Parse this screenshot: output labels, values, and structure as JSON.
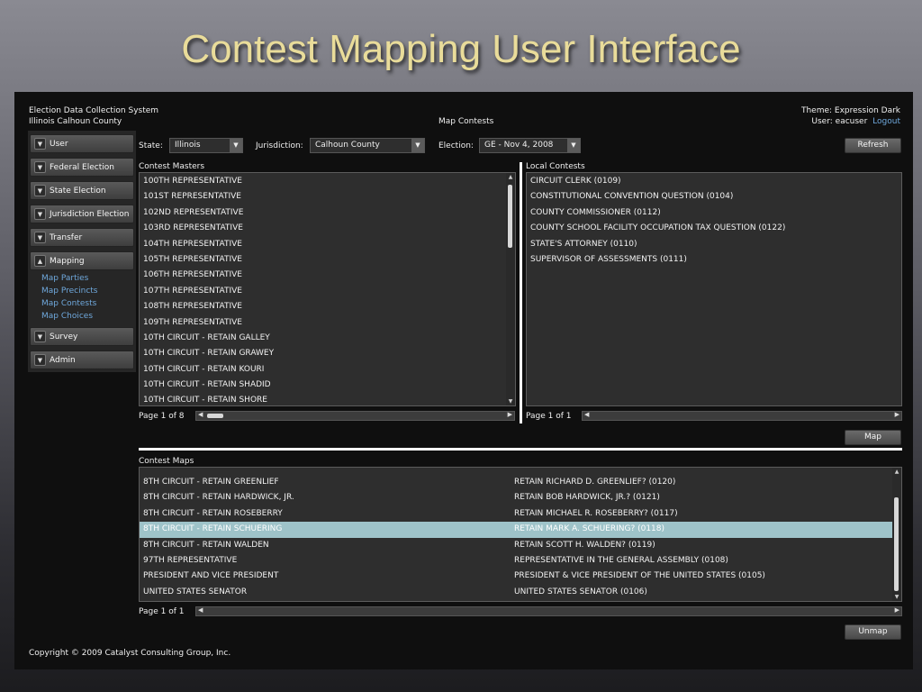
{
  "slide_title": "Contest Mapping User Interface",
  "header": {
    "system_name": "Election Data Collection System",
    "county": "Illinois Calhoun County",
    "page_name": "Map Contests",
    "theme": "Theme: Expression Dark",
    "user": "User: eacuser",
    "logout": "Logout"
  },
  "sidebar": {
    "items": [
      {
        "label": "User"
      },
      {
        "label": "Federal Election"
      },
      {
        "label": "State Election"
      },
      {
        "label": "Jurisdiction Election"
      },
      {
        "label": "Transfer"
      },
      {
        "label": "Mapping"
      }
    ],
    "mapping_links": [
      "Map Parties",
      "Map Precincts",
      "Map Contests",
      "Map Choices"
    ],
    "items_after": [
      {
        "label": "Survey"
      },
      {
        "label": "Admin"
      }
    ]
  },
  "filters": {
    "state_label": "State:",
    "state_value": "Illinois",
    "jurisdiction_label": "Jurisdiction:",
    "jurisdiction_value": "Calhoun County",
    "election_label": "Election:",
    "election_value": "GE - Nov 4, 2008",
    "refresh": "Refresh"
  },
  "contest_masters": {
    "title": "Contest Masters",
    "rows": [
      "100TH REPRESENTATIVE",
      "101ST REPRESENTATIVE",
      "102ND REPRESENTATIVE",
      "103RD REPRESENTATIVE",
      "104TH REPRESENTATIVE",
      "105TH REPRESENTATIVE",
      "106TH REPRESENTATIVE",
      "107TH REPRESENTATIVE",
      "108TH REPRESENTATIVE",
      "109TH REPRESENTATIVE",
      "10TH CIRCUIT - RETAIN GALLEY",
      "10TH CIRCUIT - RETAIN GRAWEY",
      "10TH CIRCUIT - RETAIN KOURI",
      "10TH CIRCUIT - RETAIN SHADID",
      "10TH CIRCUIT - RETAIN SHORE"
    ],
    "page": "Page 1 of 8"
  },
  "local_contests": {
    "title": "Local Contests",
    "rows": [
      "CIRCUIT CLERK (0109)",
      "CONSTITUTIONAL CONVENTION QUESTION (0104)",
      "COUNTY COMMISSIONER (0112)",
      "COUNTY SCHOOL FACILITY OCCUPATION TAX QUESTION (0122)",
      "STATE'S ATTORNEY (0110)",
      "SUPERVISOR OF ASSESSMENTS (0111)"
    ],
    "page": "Page 1 of 1",
    "map_button": "Map"
  },
  "contest_maps": {
    "title": "Contest Maps",
    "rows": [
      {
        "master": "8TH CIRCUIT - RETAIN GREENLIEF",
        "local": "RETAIN RICHARD D. GREENLIEF? (0120)",
        "selected": false
      },
      {
        "master": "8TH CIRCUIT - RETAIN HARDWICK, JR.",
        "local": "RETAIN BOB HARDWICK, JR.? (0121)",
        "selected": false
      },
      {
        "master": "8TH CIRCUIT - RETAIN ROSEBERRY",
        "local": "RETAIN MICHAEL R. ROSEBERRY? (0117)",
        "selected": false
      },
      {
        "master": "8TH CIRCUIT - RETAIN SCHUERING",
        "local": "RETAIN MARK A. SCHUERING? (0118)",
        "selected": true
      },
      {
        "master": "8TH CIRCUIT - RETAIN WALDEN",
        "local": "RETAIN SCOTT H. WALDEN? (0119)",
        "selected": false
      },
      {
        "master": "97TH REPRESENTATIVE",
        "local": "REPRESENTATIVE IN THE GENERAL ASSEMBLY (0108)",
        "selected": false
      },
      {
        "master": "PRESIDENT AND VICE PRESIDENT",
        "local": "PRESIDENT & VICE PRESIDENT OF THE UNITED STATES (0105)",
        "selected": false
      },
      {
        "master": "UNITED STATES SENATOR",
        "local": "UNITED STATES SENATOR (0106)",
        "selected": false
      }
    ],
    "page": "Page 1 of 1",
    "unmap_button": "Unmap"
  },
  "footer": {
    "copyright": "Copyright © 2009 Catalyst Consulting Group, Inc."
  }
}
